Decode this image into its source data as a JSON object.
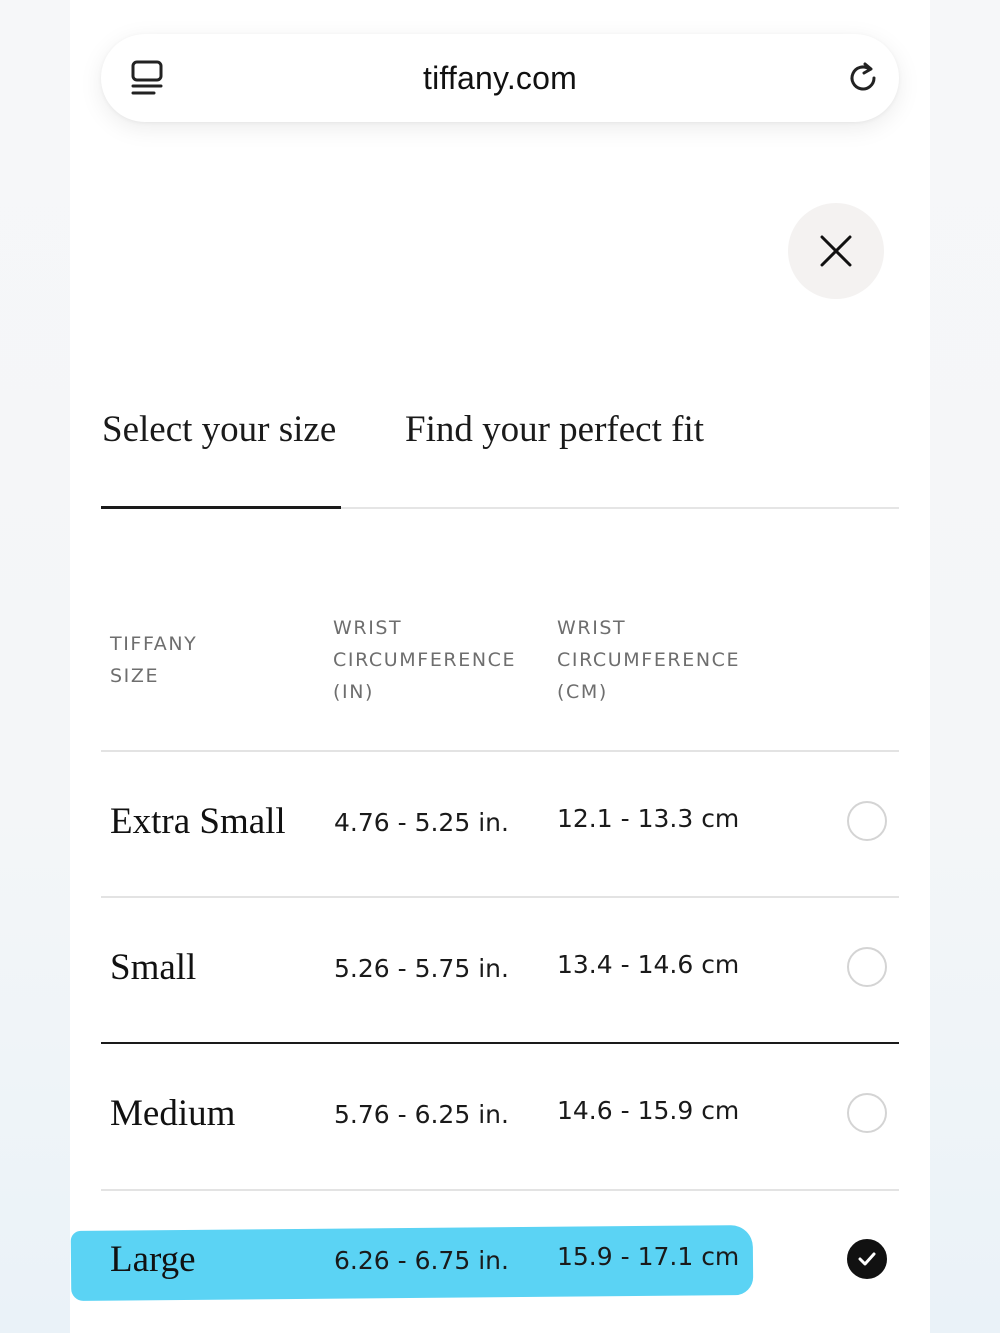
{
  "browser": {
    "url": "tiffany.com"
  },
  "tabs": [
    {
      "label": "Select your size",
      "active": true
    },
    {
      "label": "Find your perfect fit",
      "active": false
    }
  ],
  "table": {
    "headers": {
      "size_line1": "TIFFANY",
      "size_line2": "SIZE",
      "in_line1": "WRIST",
      "in_line2": "CIRCUMFERENCE",
      "in_line3": "(IN)",
      "cm_line1": "WRIST",
      "cm_line2": "CIRCUMFERENCE",
      "cm_line3": "(CM)"
    },
    "rows": [
      {
        "size": "Extra Small",
        "inches": "4.76 - 5.25 in.",
        "cm": "12.1 - 13.3 cm",
        "selected": false
      },
      {
        "size": "Small",
        "inches": "5.26 - 5.75 in.",
        "cm": "13.4 - 14.6 cm",
        "selected": false
      },
      {
        "size": "Medium",
        "inches": "5.76 - 6.25 in.",
        "cm": "14.6 - 15.9 cm",
        "selected": false
      },
      {
        "size": "Large",
        "inches": "6.26 - 6.75 in.",
        "cm": "15.9 - 17.1 cm",
        "selected": true
      }
    ]
  },
  "icons": {
    "tabs": "tabs-icon",
    "reload": "reload-icon",
    "close": "close-icon",
    "check": "checkmark-icon"
  },
  "colors": {
    "highlight": "#5bd3f4",
    "selected_radio": "#111111"
  }
}
